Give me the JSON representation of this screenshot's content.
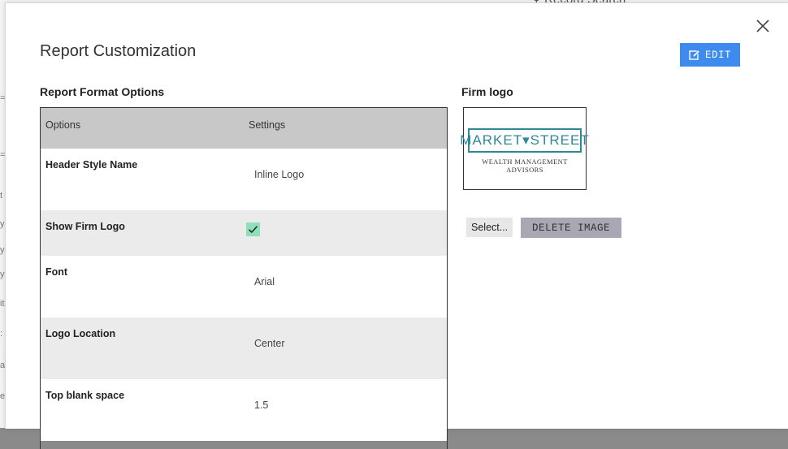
{
  "background": {
    "search_label": "Record Search"
  },
  "modal": {
    "title": "Report Customization",
    "edit_label": "EDIT"
  },
  "format": {
    "section_label": "Report Format Options",
    "columns": [
      "Options",
      "Settings"
    ],
    "rows": [
      {
        "option": "Header Style Name",
        "value": "Inline Logo"
      },
      {
        "option": "Show Firm Logo",
        "value": "",
        "checked": true
      },
      {
        "option": "Font",
        "value": "Arial"
      },
      {
        "option": "Logo Location",
        "value": "Center"
      },
      {
        "option": "Top blank space",
        "value": "1.5"
      }
    ]
  },
  "logo": {
    "section_label": "Firm logo",
    "main_text": "MARKET▾STREET",
    "sub_text": "WEALTH MANAGEMENT ADVISORS",
    "select_label": "Select...",
    "delete_label": "DELETE IMAGE"
  },
  "colors": {
    "accent": "#3d8bef",
    "checkbox": "#8fe0b9",
    "logo_teal": "#2f8896",
    "delete_button": "#a8a7b3"
  },
  "icons": {
    "close": "close-icon",
    "edit": "edit-icon",
    "check": "check-icon",
    "search": "search-icon"
  }
}
